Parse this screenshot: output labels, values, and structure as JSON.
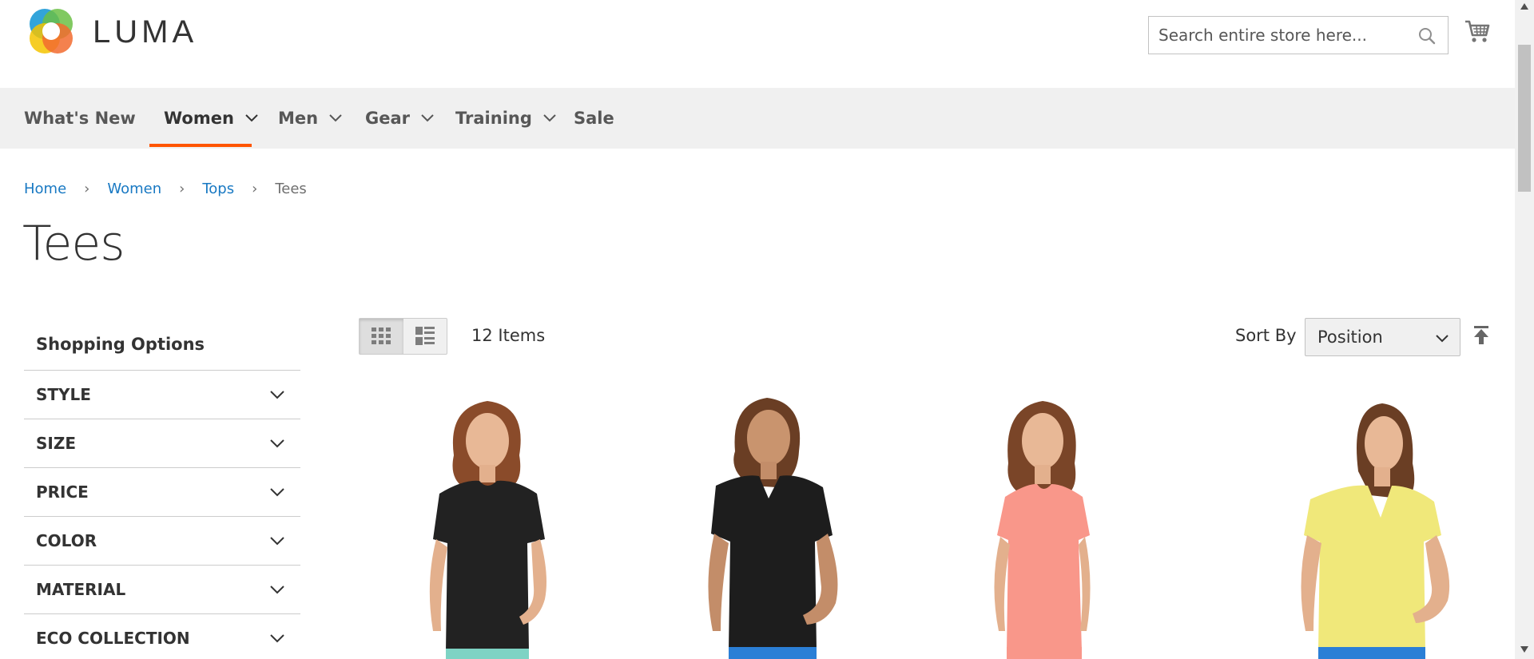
{
  "header": {
    "logo_text": "LUMA",
    "search_placeholder": "Search entire store here..."
  },
  "nav": {
    "items": [
      {
        "label": "What's New",
        "has_dropdown": false
      },
      {
        "label": "Women",
        "has_dropdown": true,
        "active": true
      },
      {
        "label": "Men",
        "has_dropdown": true
      },
      {
        "label": "Gear",
        "has_dropdown": true
      },
      {
        "label": "Training",
        "has_dropdown": true
      },
      {
        "label": "Sale",
        "has_dropdown": false
      }
    ],
    "accent_color": "#ff5501"
  },
  "breadcrumb": [
    {
      "label": "Home"
    },
    {
      "label": "Women"
    },
    {
      "label": "Tops"
    },
    {
      "label": "Tees"
    }
  ],
  "page_title": "Tees",
  "sidebar": {
    "title": "Shopping Options",
    "filters": [
      "STYLE",
      "SIZE",
      "PRICE",
      "COLOR",
      "MATERIAL",
      "ECO COLLECTION"
    ]
  },
  "toolbar": {
    "view_modes": [
      "grid",
      "list"
    ],
    "active_view": "grid",
    "item_count": "12 Items",
    "sort_label": "Sort By",
    "sort_value": "Position"
  },
  "products": [
    {
      "name": "black-scoop-tee",
      "shirt_color": "#222222",
      "pants_color": "#7ed3c4"
    },
    {
      "name": "black-vneck-tee",
      "shirt_color": "#1d1d1d",
      "pants_color": "#2b7fd6"
    },
    {
      "name": "coral-tee",
      "shirt_color": "#f9978a",
      "pants_color": "#f9978a"
    },
    {
      "name": "yellow-vneck-tee",
      "shirt_color": "#f0e87a",
      "pants_color": "#2b7fd6"
    }
  ],
  "colors": {
    "link": "#1979c3",
    "nav_bg": "#f0f0f0",
    "text": "#333333"
  }
}
